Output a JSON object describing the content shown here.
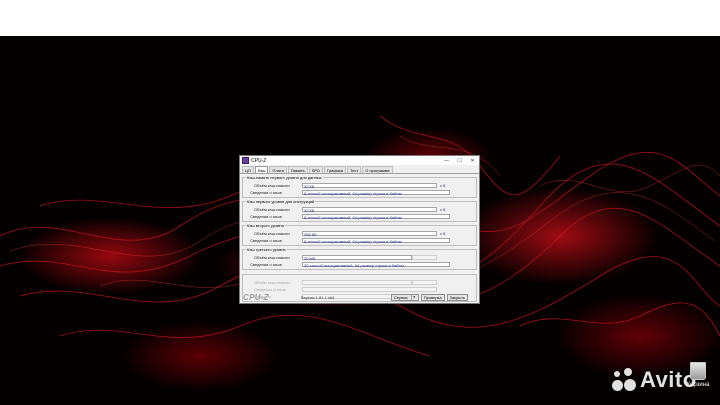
{
  "desktop": {
    "recycle_bin_label": "Корзина",
    "watermark_text": "Avito"
  },
  "window": {
    "title": "CPU-Z",
    "controls": {
      "minimize": "—",
      "maximize": "☐",
      "close": "✕"
    },
    "tabs": [
      "ЦП",
      "Кэш",
      "Плата",
      "Память",
      "SPD",
      "Графика",
      "Тест",
      "О программе"
    ],
    "active_tab": "Кэш",
    "groups": [
      {
        "title": "Кэш-память первого уровня для данных",
        "size_label": "Объём кэш-памяти",
        "size_value": "32 КБ",
        "ways": "x 8",
        "desc_label": "Сведения о кэше",
        "desc_value": "8-способ ассоциативный, 64-размер строки в байтах"
      },
      {
        "title": "Кэш первого уровня для инструкций",
        "size_label": "Объём кэш-памяти",
        "size_value": "32 КБ",
        "ways": "x 8",
        "desc_label": "Сведения о кэше",
        "desc_value": "8-способ ассоциативный, 64-размер строки в байтах"
      },
      {
        "title": "Кэш второго уровня",
        "size_label": "Объём кэш-памяти",
        "size_value": "256 КБ",
        "ways": "x 8",
        "desc_label": "Сведения о кэше",
        "desc_value": "8-способ ассоциативный, 64-размер строки в байтах"
      },
      {
        "title": "Кэш третьего уровня",
        "size_label": "Объём кэш-памяти",
        "size_value": "20 МБ",
        "ways": "",
        "desc_label": "Сведения о кэше",
        "desc_value": "20-способ ассоциативный, 64-размер строки в байтах"
      }
    ],
    "disabled_group": {
      "size_label": "Объём кэш-памяти",
      "desc_label": "Сведения о кэше",
      "speed_label": "Скорость"
    },
    "footer": {
      "logo": "CPU-Z",
      "version": "Версия 1.81.1.x64",
      "service_button": "Сервис",
      "validate_button": "Проверка",
      "close_button": "Закрыть"
    }
  }
}
